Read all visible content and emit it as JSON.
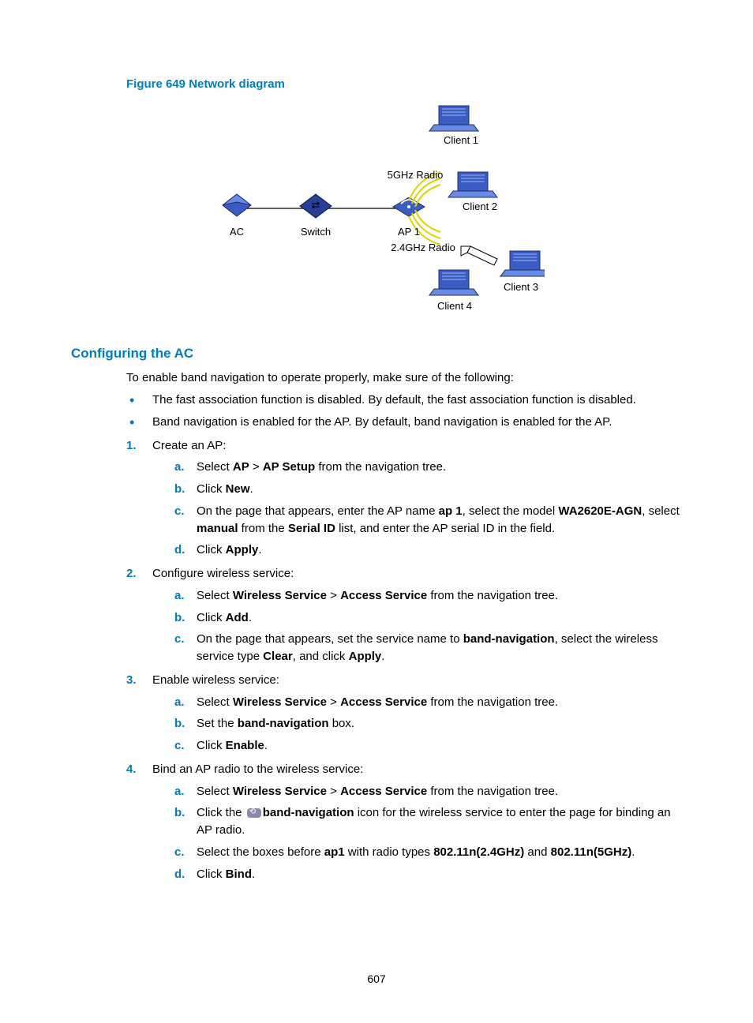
{
  "figure": {
    "caption": "Figure 649 Network diagram",
    "labels": {
      "ac": "AC",
      "switch": "Switch",
      "ap": "AP 1",
      "radio5": "5GHz Radio",
      "radio24": "2.4GHz Radio",
      "client1": "Client 1",
      "client2": "Client 2",
      "client3": "Client 3",
      "client4": "Client 4"
    }
  },
  "heading": "Configuring the AC",
  "intro": "To enable band navigation to operate properly, make sure of the following:",
  "bullets": [
    "The fast association function is disabled. By default, the fast association function is disabled.",
    "Band navigation is enabled for the AP. By default, band navigation is enabled for the AP."
  ],
  "steps": [
    {
      "text": "Create an AP:",
      "sub": [
        {
          "pre": "Select ",
          "b1": "AP",
          "mid": " > ",
          "b2": "AP Setup",
          "post": " from the navigation tree."
        },
        {
          "pre": "Click ",
          "b1": "New",
          "post": "."
        },
        {
          "pre": "On the page that appears, enter the AP name ",
          "b1": "ap 1",
          "mid": ", select the model ",
          "b2": "WA2620E-AGN",
          "mid2": ", select ",
          "b3": "manual",
          "mid3": " from the ",
          "b4": "Serial ID",
          "post": " list, and enter the AP serial ID in the field."
        },
        {
          "pre": "Click ",
          "b1": "Apply",
          "post": "."
        }
      ]
    },
    {
      "text": "Configure wireless service:",
      "sub": [
        {
          "pre": "Select ",
          "b1": "Wireless Service",
          "mid": " > ",
          "b2": "Access Service",
          "post": " from the navigation tree."
        },
        {
          "pre": "Click ",
          "b1": "Add",
          "post": "."
        },
        {
          "pre": "On the page that appears, set the service name to ",
          "b1": "band-navigation",
          "mid": ", select the wireless service type ",
          "b2": "Clear",
          "mid2": ", and click ",
          "b3": "Apply",
          "post": "."
        }
      ]
    },
    {
      "text": "Enable wireless service:",
      "sub": [
        {
          "pre": "Select ",
          "b1": "Wireless Service",
          "mid": " > ",
          "b2": "Access Service",
          "post": " from the navigation tree."
        },
        {
          "pre": "Set the ",
          "b1": "band-navigation",
          "post": " box."
        },
        {
          "pre": "Click ",
          "b1": "Enable",
          "post": "."
        }
      ]
    },
    {
      "text": "Bind an AP radio to the wireless service:",
      "sub": [
        {
          "pre": "Select ",
          "b1": "Wireless Service",
          "mid": " > ",
          "b2": "Access Service",
          "post": " from the navigation tree."
        },
        {
          "pre": "Click the ",
          "icon": true,
          "mid": " icon for the wireless service ",
          "b1": "band-navigation",
          "post": " to enter the page for binding an AP radio."
        },
        {
          "pre": "Select the boxes before ",
          "b1": "ap1",
          "mid": " with radio types ",
          "b2": "802.11n(2.4GHz)",
          "mid2": " and ",
          "b3": "802.11n(5GHz)",
          "post": "."
        },
        {
          "pre": "Click ",
          "b1": "Bind",
          "post": "."
        }
      ]
    }
  ],
  "pageNumber": "607"
}
